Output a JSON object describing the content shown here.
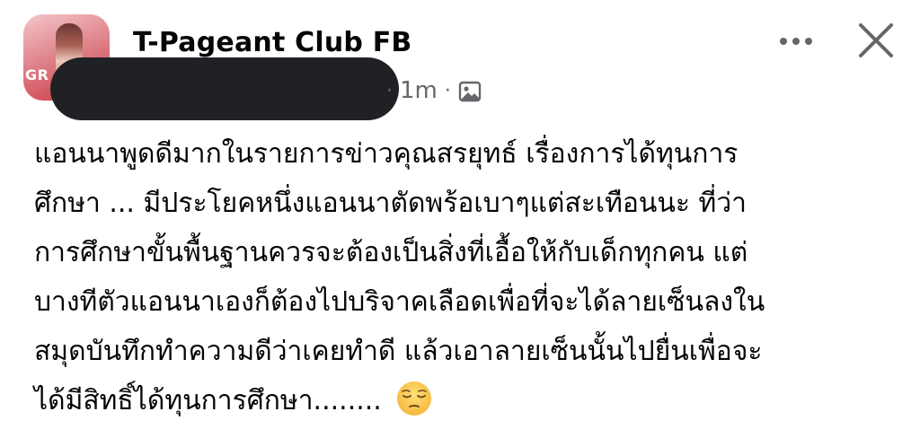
{
  "header": {
    "group_name": "T-Pageant Club FB",
    "avatar_text": "GR",
    "time": "1m",
    "separator": "·",
    "audience_icon": "photo-icon"
  },
  "actions": {
    "more_icon": "more-horizontal-icon",
    "close_icon": "close-icon"
  },
  "post": {
    "lines": [
      "แอนนาพูดดีมากในรายการข่าวคุณสรยุทธ์ เรื่องการได้ทุนการ",
      "ศึกษา ... มีประโยคหนึ่งแอนนาตัดพร้อเบาๆแต่สะเทือนนะ ที่ว่า",
      "การศึกษาขั้นพื้นฐานควรจะต้องเป็นสิ่งที่เอื้อให้กับเด็กทุกคน  แต่",
      "บางทีตัวแอนนาเองก็ต้องไปบริจาคเลือดเพื่อที่จะได้ลายเซ็นลงใน",
      "สมุดบันทึกทำความดีว่าเคยทำดี แล้วเอาลายเซ็นนั้นไปยื่นเพื่อจะ",
      "ได้มีสิทธิ์ได้ทุนการศึกษา........"
    ],
    "emoji": "pensive-face-emoji"
  },
  "colors": {
    "text": "#050505",
    "secondary": "#65676b",
    "redaction": "#202124",
    "avatar_bg": "#c9323f"
  }
}
